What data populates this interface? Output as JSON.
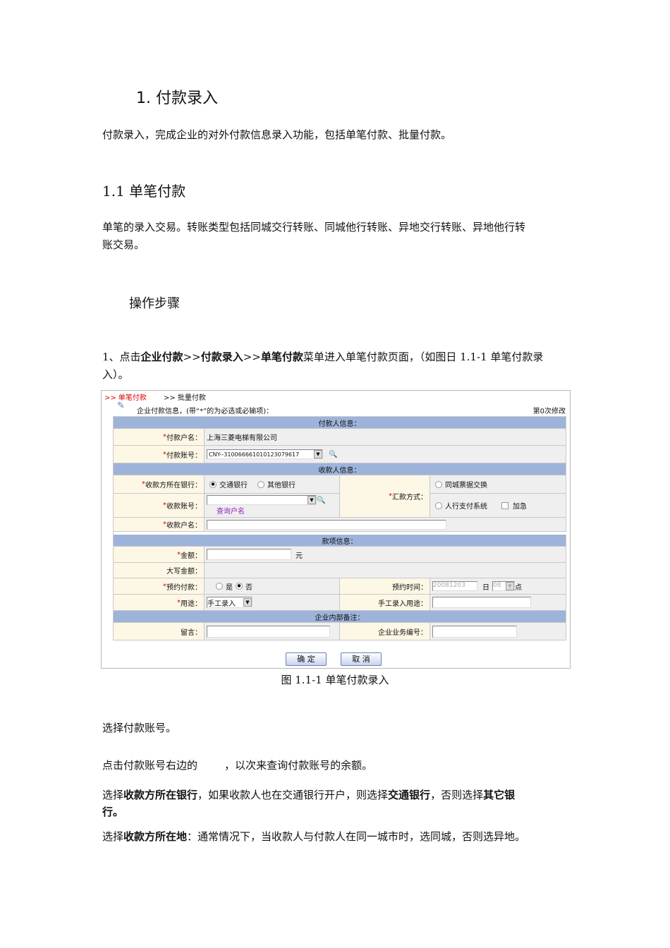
{
  "heading1": "1.  付款录入",
  "intro": "付款录入，完成企业的对外付款信息录入功能，包括单笔付款、批量付款。",
  "heading2": "1.1  单笔付款",
  "desc1": "单笔的录入交易。转账类型包括同城交行转账、同城他行转账、异地交行转账、异地他行转",
  "desc2": "账交易。",
  "steps_title": "操作步骤",
  "step1": {
    "a": "1、点击",
    "b": "企业付款",
    "c": ">>",
    "d": "付款录入",
    "e": ">>",
    "f": "单笔付款",
    "g": "菜单进入单笔付款页面，（如图日 1.1-1  单笔付款录",
    "h": "入）。"
  },
  "figure": {
    "tabs": [
      ">> 单笔付款",
      ">> 批量付款"
    ],
    "title": "企业付款信息，(带“*”的为必选或必输项)：",
    "revision": "第0次修改",
    "sections": {
      "payer": "付款人信息：",
      "payee": "收款人信息：",
      "funds": "款项信息：",
      "internal": "企业内部备注："
    },
    "payer_name_label": "付款户名：",
    "payer_name": "上海三菱电梯有限公司",
    "payer_acct_label": "付款账号：",
    "payer_acct": "CNY--310066661010123079617",
    "bank_label": "收款方所在银行：",
    "bank_options": [
      "交通银行",
      "其他银行"
    ],
    "remit_label": "汇款方式：",
    "remit_options": [
      "同城票据交换",
      "人行支付系统"
    ],
    "urgent": "加急",
    "payee_acct_label": "收款账号：",
    "query_name": "查询户名",
    "payee_name_label": "收款户名：",
    "amount_label": "金额：",
    "amount_unit": "元",
    "amount_upper_label": "大写金额：",
    "scheduled_label": "预约付款：",
    "scheduled_options": [
      "是",
      "否"
    ],
    "scheduled_time_label": "预约时间：",
    "scheduled_date": "20081203",
    "day_unit": "日",
    "hour": "08",
    "hour_unit": "点",
    "purpose_label": "用途：",
    "purpose": "手工录入",
    "manual_purpose_label": "手工录入用途：",
    "message_label": "留言：",
    "biz_no_label": "企业业务编号：",
    "ok": "确 定",
    "cancel": "取 消",
    "required_mark": "*"
  },
  "caption": "图 1.1-1 单笔付款录入",
  "s1": "选择付款账号。",
  "s2": "点击付款账号右边的        ，以次来查询付款账号的余额。",
  "s3": {
    "a": "选择",
    "b": "收款方所在银行",
    "c": "，如果收款人也在交通银行开户，则选择",
    "d": "交通银行",
    "e": "，否则选择",
    "f": "其它银",
    "g": "行。"
  },
  "s4": {
    "a": "选择",
    "b": "收款方所在地",
    "c": "：通常情况下，当收款人与付款人在同一城市时，选同城，否则选异地。"
  }
}
